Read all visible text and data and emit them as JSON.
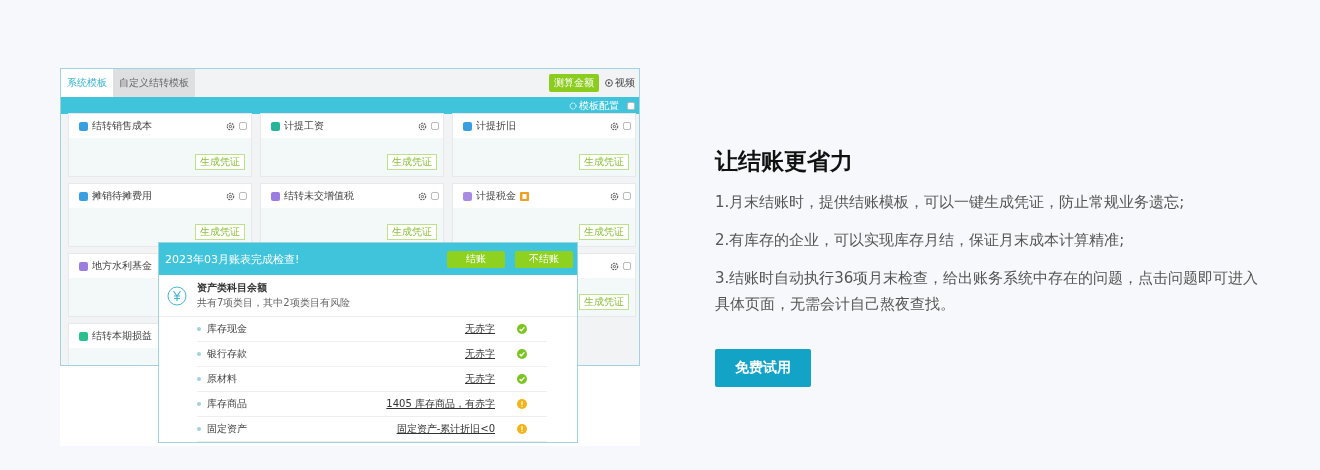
{
  "screenshot": {
    "tabs": [
      {
        "label": "系统模板",
        "selected": true
      },
      {
        "label": "自定义结转模板",
        "selected": false
      }
    ],
    "toolbar": {
      "primary_button": "测算金额",
      "video_link": "视频"
    },
    "config_bar": {
      "label": "模板配置",
      "checked": false
    },
    "card_rows": [
      [
        {
          "title": "结转销售成本",
          "color": "#3a9fe0",
          "checked": false,
          "button": "生成凭证"
        },
        {
          "title": "计提工资",
          "color": "#26b59a",
          "checked": false,
          "button": "生成凭证"
        },
        {
          "title": "计提折旧",
          "color": "#3a9fe0",
          "checked": false,
          "button": "生成凭证"
        }
      ],
      [
        {
          "title": "摊销待摊费用",
          "color": "#3a9fe0",
          "checked": false,
          "button": "生成凭证"
        },
        {
          "title": "结转未交增值税",
          "color": "#9b7de0",
          "checked": false,
          "button": "生成凭证"
        },
        {
          "title": "计提税金",
          "color": "#a98ce2",
          "flagged": true,
          "checked": false,
          "button": "生成凭证"
        }
      ],
      [
        {
          "title": "地方水利基金",
          "color": "#9b7de0"
        },
        {},
        {
          "checked": false,
          "button": "生成凭证"
        }
      ],
      [
        {
          "title": "结转本期损益",
          "color": "#2bbf8f"
        }
      ]
    ],
    "dialog": {
      "title": "2023年03月账表完成检查!",
      "buttons": [
        "结账",
        "不结账"
      ],
      "section": {
        "title": "资产类科目余额",
        "subtitle": "共有7项类目，其中2项类目有风险"
      },
      "rows": [
        {
          "name": "库存现金",
          "result": "无赤字",
          "kind": "ok"
        },
        {
          "name": "银行存款",
          "result": "无赤字",
          "kind": "ok"
        },
        {
          "name": "原材料",
          "result": "无赤字",
          "kind": "ok"
        },
        {
          "name": "库存商品",
          "result": "1405 库存商品，有赤字",
          "kind": "warn"
        },
        {
          "name": "固定资产",
          "result": "固定资产-累计折旧<0",
          "kind": "warn"
        }
      ]
    }
  },
  "feature": {
    "title": "让结账更省力",
    "points": [
      "1.月末结账时，提供结账模板，可以一键生成凭证，防止常规业务遗忘;",
      "2.有库存的企业，可以实现库存月结，保证月末成本计算精准;",
      "3.结账时自动执行36项月末检查，给出账务系统中存在的问题，点击问题即可进入具体页面，无需会计自己熬夜查找。"
    ],
    "button": "免费试用"
  }
}
